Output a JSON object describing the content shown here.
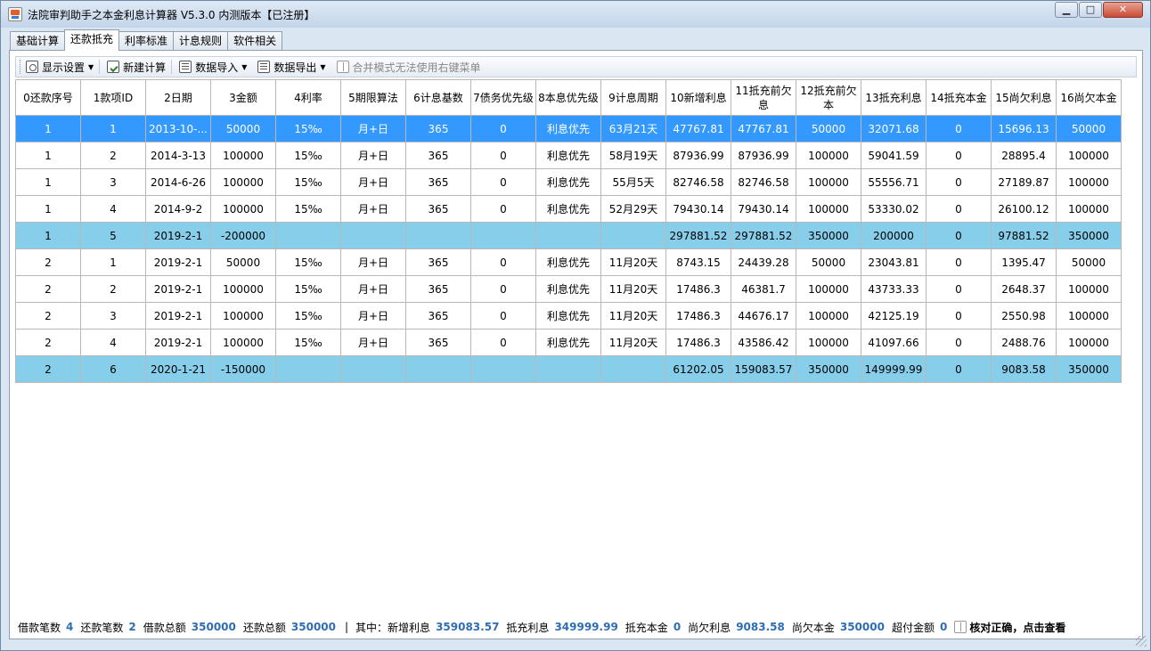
{
  "window": {
    "title": "法院审判助手之本金利息计算器 V5.3.0 内测版本【已注册】",
    "min_label": "▁",
    "max_label": "□",
    "close_label": "✕"
  },
  "tabs": [
    {
      "label": "基础计算",
      "active": false
    },
    {
      "label": "还款抵充",
      "active": true
    },
    {
      "label": "利率标准",
      "active": false
    },
    {
      "label": "计息规则",
      "active": false
    },
    {
      "label": "软件相关",
      "active": false
    }
  ],
  "toolbar": {
    "display_settings": "显示设置",
    "new_calc": "新建计算",
    "data_import": "数据导入",
    "data_export": "数据导出",
    "merge_notice": "合并模式无法使用右键菜单",
    "icons": {
      "display_settings": "monitor-settings-icon",
      "new_calc": "new-calc-icon",
      "data_import": "import-icon",
      "data_export": "export-icon",
      "merge_notice": "book-icon"
    }
  },
  "grid": {
    "columns": [
      "0还款序号",
      "1款项ID",
      "2日期",
      "3金额",
      "4利率",
      "5期限算法",
      "6计息基数",
      "7债务优先级",
      "8本息优先级",
      "9计息周期",
      "10新增利息",
      "11抵充前欠息",
      "12抵充前欠本",
      "13抵充利息",
      "14抵充本金",
      "15尚欠利息",
      "16尚欠本金"
    ],
    "rows": [
      {
        "style": "sel",
        "cells": [
          "1",
          "1",
          "2013-10-...",
          "50000",
          "15‰",
          "月+日",
          "365",
          "0",
          "利息优先",
          "63月21天",
          "47767.81",
          "47767.81",
          "50000",
          "32071.68",
          "0",
          "15696.13",
          "50000"
        ]
      },
      {
        "style": "",
        "cells": [
          "1",
          "2",
          "2014-3-13",
          "100000",
          "15‰",
          "月+日",
          "365",
          "0",
          "利息优先",
          "58月19天",
          "87936.99",
          "87936.99",
          "100000",
          "59041.59",
          "0",
          "28895.4",
          "100000"
        ]
      },
      {
        "style": "",
        "cells": [
          "1",
          "3",
          "2014-6-26",
          "100000",
          "15‰",
          "月+日",
          "365",
          "0",
          "利息优先",
          "55月5天",
          "82746.58",
          "82746.58",
          "100000",
          "55556.71",
          "0",
          "27189.87",
          "100000"
        ]
      },
      {
        "style": "",
        "cells": [
          "1",
          "4",
          "2014-9-2",
          "100000",
          "15‰",
          "月+日",
          "365",
          "0",
          "利息优先",
          "52月29天",
          "79430.14",
          "79430.14",
          "100000",
          "53330.02",
          "0",
          "26100.12",
          "100000"
        ]
      },
      {
        "style": "sum",
        "cells": [
          "1",
          "5",
          "2019-2-1",
          "-200000",
          "",
          "",
          "",
          "",
          "",
          "",
          "297881.52",
          "297881.52",
          "350000",
          "200000",
          "0",
          "97881.52",
          "350000"
        ]
      },
      {
        "style": "",
        "cells": [
          "2",
          "1",
          "2019-2-1",
          "50000",
          "15‰",
          "月+日",
          "365",
          "0",
          "利息优先",
          "11月20天",
          "8743.15",
          "24439.28",
          "50000",
          "23043.81",
          "0",
          "1395.47",
          "50000"
        ]
      },
      {
        "style": "",
        "cells": [
          "2",
          "2",
          "2019-2-1",
          "100000",
          "15‰",
          "月+日",
          "365",
          "0",
          "利息优先",
          "11月20天",
          "17486.3",
          "46381.7",
          "100000",
          "43733.33",
          "0",
          "2648.37",
          "100000"
        ]
      },
      {
        "style": "",
        "cells": [
          "2",
          "3",
          "2019-2-1",
          "100000",
          "15‰",
          "月+日",
          "365",
          "0",
          "利息优先",
          "11月20天",
          "17486.3",
          "44676.17",
          "100000",
          "42125.19",
          "0",
          "2550.98",
          "100000"
        ]
      },
      {
        "style": "",
        "cells": [
          "2",
          "4",
          "2019-2-1",
          "100000",
          "15‰",
          "月+日",
          "365",
          "0",
          "利息优先",
          "11月20天",
          "17486.3",
          "43586.42",
          "100000",
          "41097.66",
          "0",
          "2488.76",
          "100000"
        ]
      },
      {
        "style": "sum",
        "cells": [
          "2",
          "6",
          "2020-1-21",
          "-150000",
          "",
          "",
          "",
          "",
          "",
          "",
          "61202.05",
          "159083.57",
          "350000",
          "149999.99",
          "0",
          "9083.58",
          "350000"
        ]
      }
    ]
  },
  "status": {
    "loan_count_label": "借款笔数",
    "loan_count": "4",
    "repay_count_label": "还款笔数",
    "repay_count": "2",
    "loan_total_label": "借款总额",
    "loan_total": "350000",
    "repay_total_label": "还款总额",
    "repay_total": "350000",
    "separator": "|",
    "new_interest_label": "其中：新增利息",
    "new_interest": "359083.57",
    "offset_interest_label": "抵充利息",
    "offset_interest": "349999.99",
    "offset_principal_label": "抵充本金",
    "offset_principal": "0",
    "owed_interest_label": "尚欠利息",
    "owed_interest": "9083.58",
    "owed_principal_label": "尚欠本金",
    "owed_principal": "350000",
    "overpaid_label": "超付金额",
    "overpaid": "0",
    "check_ok": "核对正确，点击查看"
  },
  "colors": {
    "selected_row": "#3399ff",
    "summary_row": "#87ceeb",
    "status_value": "#2e6db4"
  }
}
